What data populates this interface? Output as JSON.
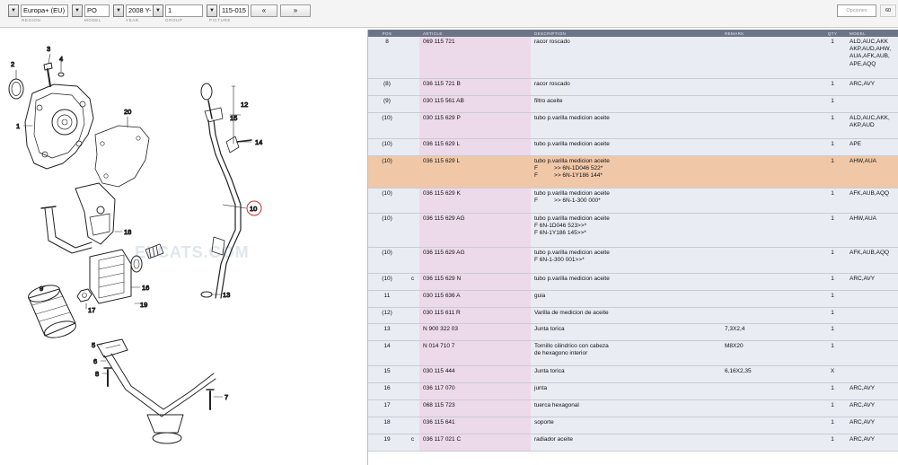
{
  "toolbar": {
    "region": "Europa+ (EU)",
    "model": "PO",
    "year": "2008",
    "year_suffix": "Y-",
    "group": "1",
    "picture": "115-015",
    "prev": "«",
    "next": "»",
    "search_placeholder": "Opciones",
    "search_button": "60",
    "dropdown_glyph": "▼",
    "labels": {
      "region": "REGION",
      "model": "MODEL",
      "year": "YEAR",
      "group": "GROUP",
      "picture": "PICTURE"
    }
  },
  "table": {
    "headers": {
      "pos": "POS",
      "article": "ARTICLE",
      "description": "DESCRIPTION",
      "remark": "REMARK",
      "qty": "QTY",
      "model": "MODEL"
    },
    "rows": [
      {
        "pos": "8",
        "mark": "",
        "article": "069 115 721",
        "desc": [
          "racor roscado"
        ],
        "remark": "",
        "qty": "1",
        "model": [
          "ALD,AUC,AKK",
          "AKP,AUD,AHW,",
          "AUA,AFK,AUB,",
          "APE,AQQ"
        ],
        "h": 46
      },
      {
        "pos": "(8)",
        "mark": "",
        "article": "036 115 721 B",
        "desc": [
          "racor roscado"
        ],
        "remark": "",
        "qty": "1",
        "model": [
          "ARC,AVY"
        ],
        "h": 19
      },
      {
        "pos": "(9)",
        "mark": "",
        "article": "030 115 561 AB",
        "desc": [
          "filtro aceite"
        ],
        "remark": "",
        "qty": "1",
        "model": [
          ""
        ],
        "h": 19
      },
      {
        "pos": "(10)",
        "mark": "",
        "article": "030 115 629 P",
        "desc": [
          "tubo p.varilla medicion aceite"
        ],
        "remark": "",
        "qty": "1",
        "model": [
          "ALD,AUC,AKK,",
          "AKP,AUD"
        ],
        "h": 29
      },
      {
        "pos": "(10)",
        "mark": "",
        "article": "036 115 629 L",
        "desc": [
          "tubo p.varilla medicion aceite"
        ],
        "remark": "",
        "qty": "1",
        "model": [
          "APE"
        ],
        "h": 19
      },
      {
        "pos": "(10)",
        "mark": "",
        "article": "036 115 629 L",
        "desc": [
          "tubo p.varilla medicion aceite",
          "F          >> 6N-1D046 522*",
          "F          >> 6N-1Y186 144*"
        ],
        "remark": "",
        "qty": "1",
        "model": [
          "AHW,AUA"
        ],
        "h": 36,
        "highlight": true
      },
      {
        "pos": "(10)",
        "mark": "",
        "article": "036 115 629 K",
        "desc": [
          "tubo p.varilla medicion aceite",
          "F          >> 6N-1-300 000*"
        ],
        "remark": "",
        "qty": "1",
        "model": [
          "AFK,AUB,AQQ"
        ],
        "h": 28
      },
      {
        "pos": "(10)",
        "mark": "",
        "article": "036 115 629 AG",
        "desc": [
          "tubo p.varilla medicion aceite",
          "F 6N-1D046 523>>*",
          "F 6N-1Y186 145>>*"
        ],
        "remark": "",
        "qty": "1",
        "model": [
          "AHW,AUA"
        ],
        "h": 38
      },
      {
        "pos": "(10)",
        "mark": "",
        "article": "036 115 629 AG",
        "desc": [
          "tubo p.varilla medicion aceite",
          "F 6N-1-300 001>>*"
        ],
        "remark": "",
        "qty": "1",
        "model": [
          "AFK,AUB,AQQ"
        ],
        "h": 29
      },
      {
        "pos": "(10)",
        "mark": "c",
        "article": "036 115 629 N",
        "desc": [
          "tubo p.varilla medicion aceite"
        ],
        "remark": "",
        "qty": "1",
        "model": [
          "ARC,AVY"
        ],
        "h": 19
      },
      {
        "pos": "11",
        "mark": "",
        "article": "030 115 636 A",
        "desc": [
          "guia"
        ],
        "remark": "",
        "qty": "1",
        "model": [
          ""
        ],
        "h": 19
      },
      {
        "pos": "(12)",
        "mark": "",
        "article": "030 115 611 R",
        "desc": [
          "Varilla de medicion de aceite"
        ],
        "remark": "",
        "qty": "1",
        "model": [
          ""
        ],
        "h": 18
      },
      {
        "pos": "13",
        "mark": "",
        "article": "N  900 322 03",
        "desc": [
          "Junta torica"
        ],
        "remark": "7,3X2,4",
        "qty": "1",
        "model": [
          ""
        ],
        "h": 19
      },
      {
        "pos": "14",
        "mark": "",
        "article": "N  014 710 7",
        "desc": [
          "Tornillo cilindrico con cabeza",
          "de hexagono interior"
        ],
        "remark": "M8X20",
        "qty": "1",
        "model": [
          ""
        ],
        "h": 28
      },
      {
        "pos": "15",
        "mark": "",
        "article": "030 115 444",
        "desc": [
          "Junta torica"
        ],
        "remark": "6,16X2,35",
        "qty": "X",
        "model": [
          ""
        ],
        "h": 19
      },
      {
        "pos": "16",
        "mark": "",
        "article": "036 117 070",
        "desc": [
          "junta"
        ],
        "remark": "",
        "qty": "1",
        "model": [
          "ARC,AVY"
        ],
        "h": 19
      },
      {
        "pos": "17",
        "mark": "",
        "article": "068 115 723",
        "desc": [
          "tuerca hexagonal"
        ],
        "remark": "",
        "qty": "1",
        "model": [
          "ARC,AVY"
        ],
        "h": 19
      },
      {
        "pos": "18",
        "mark": "",
        "article": "036 115 641",
        "desc": [
          "soporte"
        ],
        "remark": "",
        "qty": "1",
        "model": [
          "ARC,AVY"
        ],
        "h": 19
      },
      {
        "pos": "19",
        "mark": "c",
        "article": "036 117 021 C",
        "desc": [
          "radiador aceite"
        ],
        "remark": "",
        "qty": "1",
        "model": [
          "ARC,AVY"
        ],
        "h": 19
      }
    ]
  },
  "diagram": {
    "callouts": [
      "1",
      "2",
      "3",
      "4",
      "5",
      "6",
      "7",
      "8",
      "9",
      "10",
      "12",
      "13",
      "14",
      "15",
      "16",
      "17",
      "18",
      "19",
      "20"
    ],
    "watermark": "ELCATS.COM"
  }
}
